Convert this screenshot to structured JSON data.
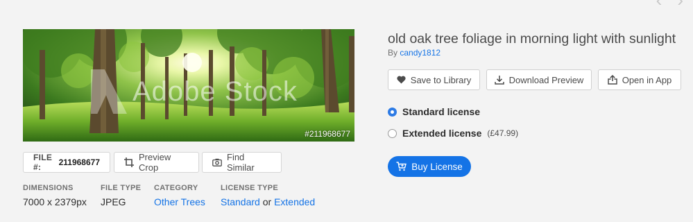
{
  "nav": {
    "prev_icon": "chevron-left-icon",
    "next_icon": "chevron-right-icon"
  },
  "preview": {
    "watermark_text": "Adobe Stock",
    "file_id_label": "#211968677"
  },
  "file_chip": {
    "label": "FILE #:",
    "value": "211968677"
  },
  "preview_crop": {
    "label": "Preview Crop",
    "icon": "crop-icon"
  },
  "find_similar": {
    "label": "Find Similar",
    "icon": "camera-icon"
  },
  "metadata": {
    "dimensions": {
      "key": "DIMENSIONS",
      "value": "7000 x 2379px"
    },
    "file_type": {
      "key": "FILE TYPE",
      "value": "JPEG"
    },
    "category": {
      "key": "CATEGORY",
      "value": "Other Trees"
    },
    "license_type": {
      "key": "LICENSE TYPE",
      "standard": "Standard",
      "or": "or",
      "extended": "Extended"
    }
  },
  "asset": {
    "title": "old oak tree foliage in morning light with sunlight",
    "by_label": "By",
    "author": "candy1812"
  },
  "actions": {
    "save": {
      "label": "Save to Library",
      "icon": "heart-icon"
    },
    "download": {
      "label": "Download Preview",
      "icon": "download-icon"
    },
    "open": {
      "label": "Open in App",
      "icon": "share-icon"
    }
  },
  "license": {
    "standard": {
      "label": "Standard license",
      "selected": true
    },
    "extended": {
      "label": "Extended license",
      "price": "(£47.99)",
      "selected": false
    }
  },
  "buy": {
    "label": "Buy License",
    "icon": "cart-icon"
  },
  "colors": {
    "accent": "#1473e6",
    "background": "#f3f3f3"
  }
}
